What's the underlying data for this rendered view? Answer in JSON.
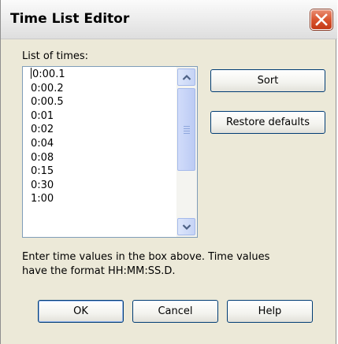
{
  "window": {
    "title": "Time List Editor"
  },
  "list": {
    "label": "List of times:",
    "items": [
      "0:00.1",
      "0:00.2",
      "0:00.5",
      "0:01",
      "0:02",
      "0:04",
      "0:08",
      "0:15",
      "0:30",
      "1:00"
    ]
  },
  "buttons": {
    "sort": "Sort",
    "restore": "Restore defaults",
    "ok": "OK",
    "cancel": "Cancel",
    "help": "Help"
  },
  "instructions": {
    "line1": "Enter time values in the box above. Time values",
    "line2": "have the format HH:MM:SS.D."
  },
  "colors": {
    "close_button": "#d9552f",
    "window_bg": "#ece9d8",
    "scrollbar_accent": "#c5d3f5"
  }
}
